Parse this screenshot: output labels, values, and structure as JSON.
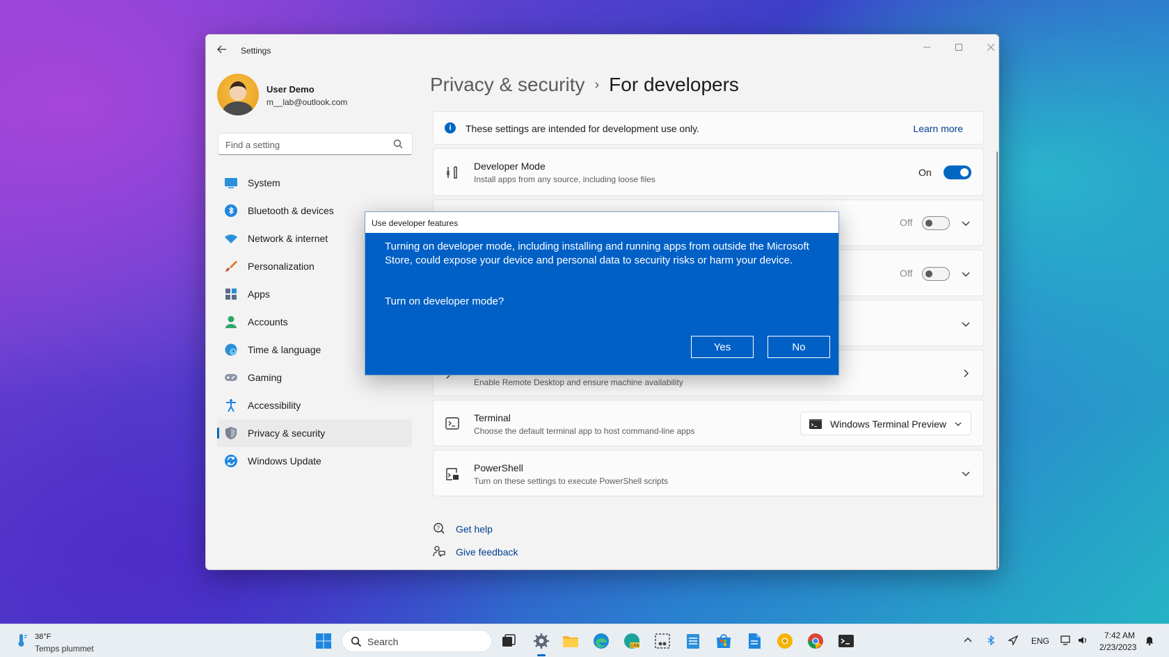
{
  "window": {
    "title": "Settings",
    "back_icon": "arrow-left-icon"
  },
  "user": {
    "name": "User Demo",
    "email": "m__lab@outlook.com"
  },
  "search": {
    "placeholder": "Find a setting"
  },
  "nav": {
    "items": [
      {
        "label": "System",
        "icon": "system-icon"
      },
      {
        "label": "Bluetooth & devices",
        "icon": "bluetooth-icon"
      },
      {
        "label": "Network & internet",
        "icon": "wifi-icon"
      },
      {
        "label": "Personalization",
        "icon": "paintbrush-icon"
      },
      {
        "label": "Apps",
        "icon": "apps-icon"
      },
      {
        "label": "Accounts",
        "icon": "accounts-icon"
      },
      {
        "label": "Time & language",
        "icon": "globe-clock-icon"
      },
      {
        "label": "Gaming",
        "icon": "gamepad-icon"
      },
      {
        "label": "Accessibility",
        "icon": "accessibility-icon"
      },
      {
        "label": "Privacy & security",
        "icon": "shield-icon"
      },
      {
        "label": "Windows Update",
        "icon": "update-icon"
      }
    ],
    "active": "Privacy & security"
  },
  "breadcrumb": {
    "parent": "Privacy & security",
    "separator": "›",
    "current": "For developers"
  },
  "info_banner": {
    "text": "These settings are intended for development use only.",
    "link": "Learn more"
  },
  "developer_mode": {
    "title": "Developer Mode",
    "description": "Install apps from any source, including loose files",
    "state_label": "On"
  },
  "collapsed_rows": {
    "row1_state": "Off",
    "row2_state": "Off"
  },
  "remote_desktop": {
    "description": "Enable Remote Desktop and ensure machine availability"
  },
  "terminal": {
    "title": "Terminal",
    "description": "Choose the default terminal app to host command-line apps",
    "selected": "Windows Terminal Preview"
  },
  "powershell": {
    "title": "PowerShell",
    "description": "Turn on these settings to execute PowerShell scripts"
  },
  "help": {
    "get_help": "Get help",
    "give_feedback": "Give feedback"
  },
  "dialog": {
    "title": "Use developer features",
    "message": "Turning on developer mode, including installing and running apps from outside the Microsoft Store, could expose your device and personal data to security risks or harm your device.",
    "question": "Turn on developer mode?",
    "yes": "Yes",
    "no": "No"
  },
  "taskbar": {
    "weather_temp": "38°F",
    "weather_condition": "Temps plummet",
    "search_label": "Search",
    "language": "ENG",
    "time": "7:42 AM",
    "date": "2/23/2023"
  },
  "colors": {
    "accent": "#0067c0",
    "dialog_bg": "#0060c6",
    "link": "#003e92"
  }
}
